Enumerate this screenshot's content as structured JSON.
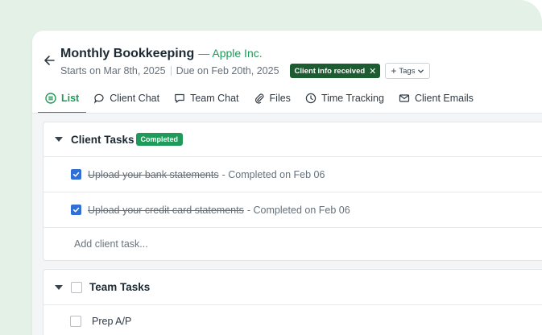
{
  "header": {
    "title": "Monthly Bookkeeping",
    "client": "— Apple Inc.",
    "starts": "Starts on Mar 8th, 2025",
    "due": "Due on Feb 20th, 2025",
    "status_tag": "Client info received",
    "tags_label": "Tags"
  },
  "tabs": [
    {
      "label": "List",
      "icon": "list-icon",
      "active": true
    },
    {
      "label": "Client Chat",
      "icon": "chat-icon"
    },
    {
      "label": "Team Chat",
      "icon": "message-icon"
    },
    {
      "label": "Files",
      "icon": "paperclip-icon"
    },
    {
      "label": "Time Tracking",
      "icon": "clock-icon"
    },
    {
      "label": "Client Emails",
      "icon": "mail-icon"
    }
  ],
  "client_tasks": {
    "title": "Client Tasks",
    "badge": "Completed",
    "items": [
      {
        "name": "Upload your bank statements",
        "status": "- Completed on Feb 06",
        "checked": true
      },
      {
        "name": "Upload your credit card statements",
        "status": "- Completed on Feb 06",
        "checked": true
      }
    ],
    "add_placeholder": "Add client task..."
  },
  "team_tasks": {
    "title": "Team Tasks",
    "items": [
      {
        "name": "Prep A/P",
        "checked": false
      }
    ]
  },
  "colors": {
    "accent": "#1f9a5a",
    "status_pill": "#1d5c31",
    "checkbox": "#2f6fd6",
    "background": "#e3f1e6"
  }
}
